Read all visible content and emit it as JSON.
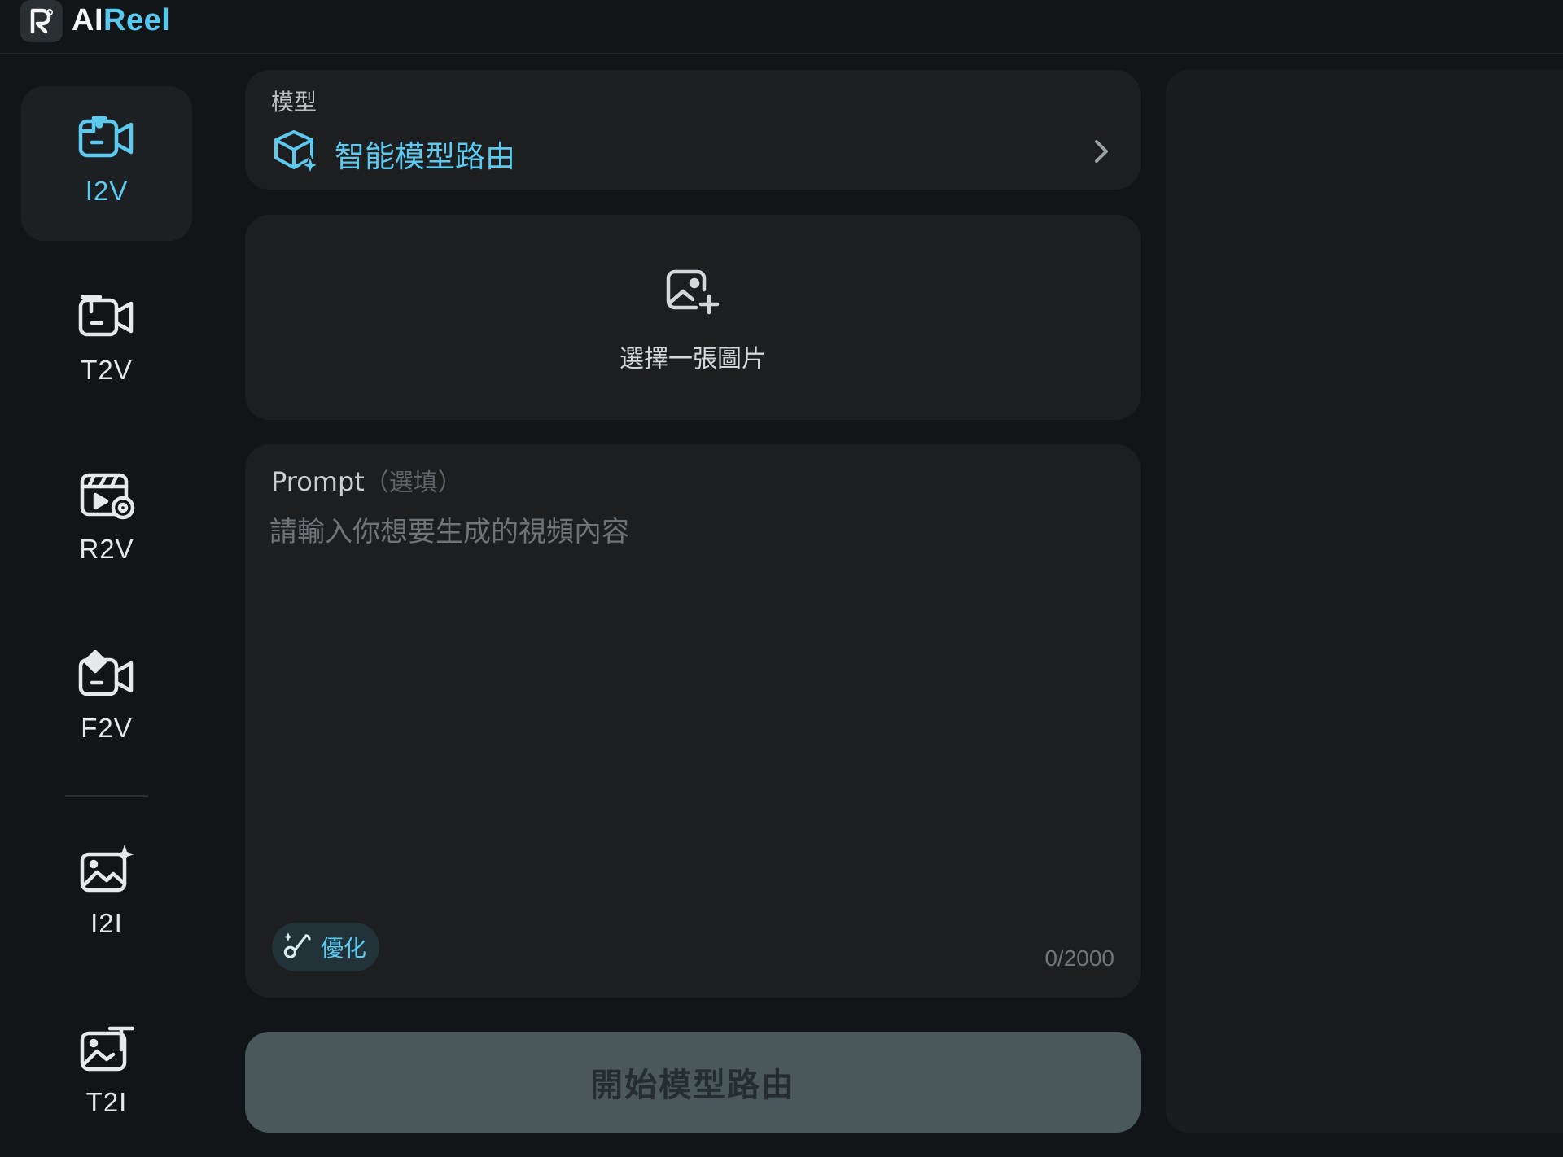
{
  "app": {
    "brand_prefix": "AI",
    "brand_suffix": "Reel",
    "accent_color": "#5cc9ef"
  },
  "sidebar": {
    "items": [
      {
        "label": "I2V",
        "icon": "image-to-video-icon",
        "active": true
      },
      {
        "label": "T2V",
        "icon": "text-to-video-icon",
        "active": false
      },
      {
        "label": "R2V",
        "icon": "reference-to-video-icon",
        "active": false
      },
      {
        "label": "F2V",
        "icon": "frame-to-video-icon",
        "active": false
      },
      {
        "label": "I2I",
        "icon": "image-to-image-icon",
        "active": false
      },
      {
        "label": "T2I",
        "icon": "text-to-image-icon",
        "active": false
      }
    ]
  },
  "model": {
    "caption": "模型",
    "value": "智能模型路由",
    "icon": "cube-sparkle-icon"
  },
  "upload": {
    "label": "選擇一張圖片",
    "icon": "image-add-icon"
  },
  "prompt": {
    "label": "Prompt",
    "optional": "（選填）",
    "placeholder": "請輸入你想要生成的視頻內容",
    "value": "",
    "optimize_label": "優化",
    "counter": "0/2000"
  },
  "start_button": {
    "label": "開始模型路由"
  }
}
